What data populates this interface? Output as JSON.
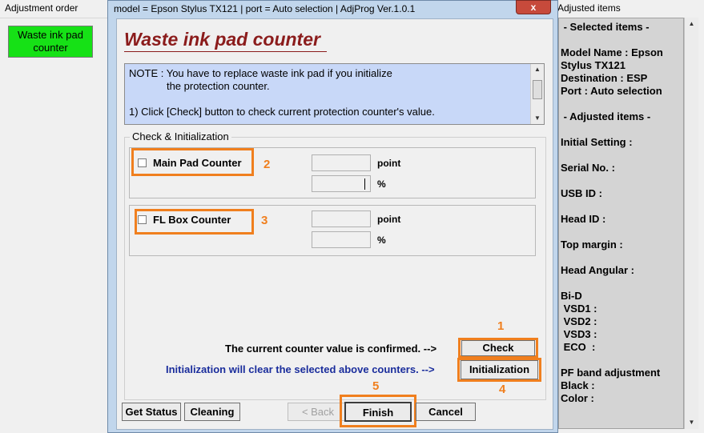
{
  "left_panel": {
    "title": "Adjustment order",
    "waste_button": "Waste ink pad counter"
  },
  "right_panel": {
    "title": "Adjusted items",
    "lines": [
      " - Selected items -",
      "",
      "Model Name : Epson",
      "Stylus TX121",
      "Destination : ESP",
      "Port : Auto selection",
      "",
      " - Adjusted items -",
      "",
      "Initial Setting :",
      "",
      "Serial No. :",
      "",
      "USB ID :",
      "",
      "Head ID :",
      "",
      "Top margin :",
      "",
      "Head Angular :",
      "",
      "Bi-D",
      " VSD1 :",
      " VSD2 :",
      " VSD3 :",
      " ECO  :",
      "",
      "PF band adjustment",
      "Black :",
      "Color :"
    ]
  },
  "dialog": {
    "title": "model = Epson Stylus TX121 | port = Auto selection | AdjProg Ver.1.0.1",
    "close_label": "x",
    "heading": "Waste ink pad counter",
    "note_lines": [
      "NOTE : You have to replace waste ink pad if you initialize",
      "             the protection counter.",
      "",
      "1) Click [Check] button to check current protection counter's value."
    ],
    "group_label": "Check & Initialization",
    "main_counter": {
      "label": "Main Pad Counter",
      "point_value": "",
      "percent_value": "",
      "point_unit": "point",
      "percent_unit": "%",
      "step": "2"
    },
    "fl_counter": {
      "label": "FL Box Counter",
      "point_value": "",
      "percent_value": "",
      "point_unit": "point",
      "percent_unit": "%",
      "step": "3"
    },
    "check_message": "The current counter value is confirmed. -->",
    "init_message": "Initialization will clear the selected above counters. -->",
    "check_button": "Check",
    "init_button": "Initialization",
    "check_step": "1",
    "init_step": "4",
    "finish_step": "5",
    "buttons": {
      "get_status": "Get Status",
      "cleaning": "Cleaning",
      "back": "< Back",
      "finish": "Finish",
      "cancel": "Cancel"
    }
  },
  "colors": {
    "highlight": "#f07f1e",
    "waste_button_bg": "#16e116",
    "heading": "#8b1c1c",
    "note_bg": "#c8d8f8",
    "init_message": "#1a2d9c"
  }
}
